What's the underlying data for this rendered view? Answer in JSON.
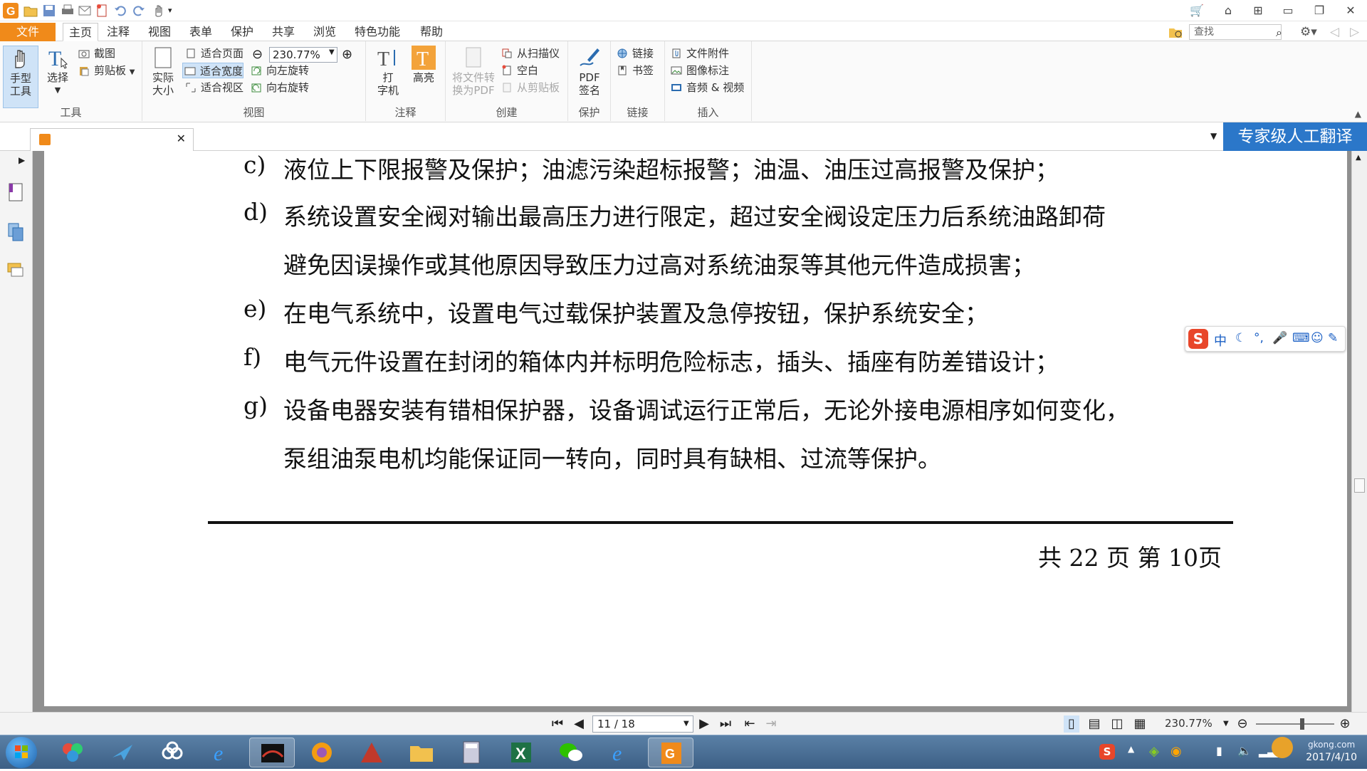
{
  "app": {
    "window_title": "",
    "file_menu": "文件",
    "tabs": [
      {
        "label": "主页",
        "active": true
      },
      {
        "label": "注释"
      },
      {
        "label": "视图"
      },
      {
        "label": "表单"
      },
      {
        "label": "保护"
      },
      {
        "label": "共享"
      },
      {
        "label": "浏览"
      },
      {
        "label": "特色功能"
      },
      {
        "label": "帮助"
      }
    ],
    "search_placeholder": "查找"
  },
  "ribbon": {
    "tools": {
      "label": "工具",
      "hand": "手型\n工具",
      "select": "选择",
      "screenshot": "截图",
      "clipboard": "剪贴板"
    },
    "view": {
      "label": "视图",
      "actual_size": "实际\n大小",
      "fit_page": "适合页面",
      "fit_width": "适合宽度",
      "fit_view": "适合视区",
      "zoom": "230.77%",
      "rotate_left": "向左旋转",
      "rotate_right": "向右旋转"
    },
    "annotate": {
      "label": "注释",
      "typewriter": "打\n字机",
      "highlight": "高亮"
    },
    "create": {
      "label": "创建",
      "convert": "将文件转\n换为PDF",
      "from_scanner": "从扫描仪",
      "blank": "空白",
      "from_clipboard": "从剪贴板"
    },
    "protect": {
      "label": "保护",
      "pdf_sign": "PDF\n签名"
    },
    "links": {
      "label": "链接",
      "link": "链接",
      "bookmark": "书签"
    },
    "insert": {
      "label": "插入",
      "attachment": "文件附件",
      "image_annot": "图像标注",
      "audio_video": "音频 & 视频"
    }
  },
  "banner": "专家级人工翻译",
  "document": {
    "items": [
      {
        "marker": "c)",
        "lines": [
          "液位上下限报警及保护；油滤污染超标报警；油温、油压过高报警及保护；"
        ]
      },
      {
        "marker": "d)",
        "lines": [
          "系统设置安全阀对输出最高压力进行限定，超过安全阀设定压力后系统油路卸荷",
          "避免因误操作或其他原因导致压力过高对系统油泵等其他元件造成损害；"
        ]
      },
      {
        "marker": "e)",
        "lines": [
          "在电气系统中，设置电气过载保护装置及急停按钮，保护系统安全；"
        ]
      },
      {
        "marker": "f)",
        "lines": [
          "电气元件设置在封闭的箱体内并标明危险标志，插头、插座有防差错设计；"
        ]
      },
      {
        "marker": "g)",
        "lines": [
          "设备电器安装有错相保护器，设备调试运行正常后，无论外接电源相序如何变化，",
          "泵组油泵电机均能保证同一转向，同时具有缺相、过流等保护。"
        ]
      }
    ],
    "page_counter": "共 22 页  第 10页"
  },
  "statusbar": {
    "page_field": "11 / 18",
    "zoom": "230.77%"
  },
  "ime": {
    "mode": "中"
  },
  "taskbar": {
    "date": "2017/4/10",
    "watermark": "gkong.com"
  }
}
